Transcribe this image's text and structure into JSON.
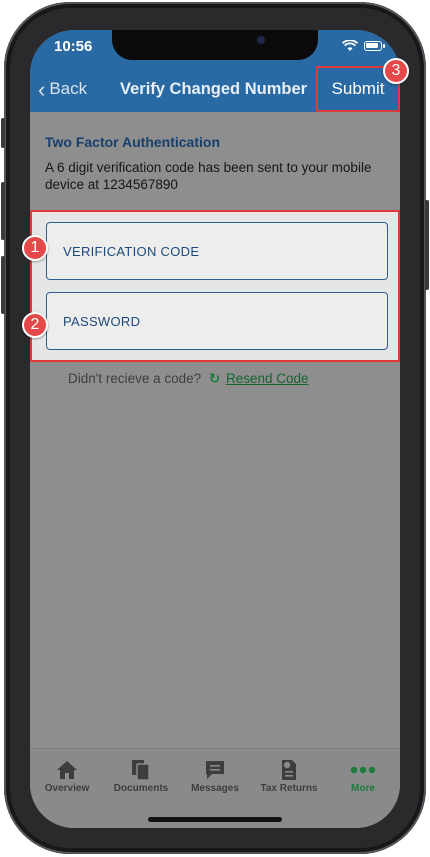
{
  "status_bar": {
    "time": "10:56"
  },
  "nav": {
    "back_label": "Back",
    "title": "Verify Changed Number",
    "submit_label": "Submit"
  },
  "content": {
    "section_title": "Two Factor Authentication",
    "info_text": "A 6 digit verification code has been sent to your mobile device at 1234567890",
    "verification_placeholder": "VERIFICATION CODE",
    "password_placeholder": "PASSWORD",
    "resend_prompt": "Didn't recieve a code?",
    "resend_link": "Resend Code"
  },
  "tabs": [
    {
      "label": "Overview",
      "icon": "home-icon"
    },
    {
      "label": "Documents",
      "icon": "documents-icon"
    },
    {
      "label": "Messages",
      "icon": "message-icon"
    },
    {
      "label": "Tax Returns",
      "icon": "tax-return-icon"
    },
    {
      "label": "More",
      "icon": "more-dots-icon",
      "active": true
    }
  ],
  "annotations": [
    "1",
    "2",
    "3"
  ],
  "colors": {
    "nav_blue": "#2a6aa4",
    "highlight_red": "#e03a3a",
    "link_green": "#14652f",
    "field_border": "#2d5f92"
  }
}
